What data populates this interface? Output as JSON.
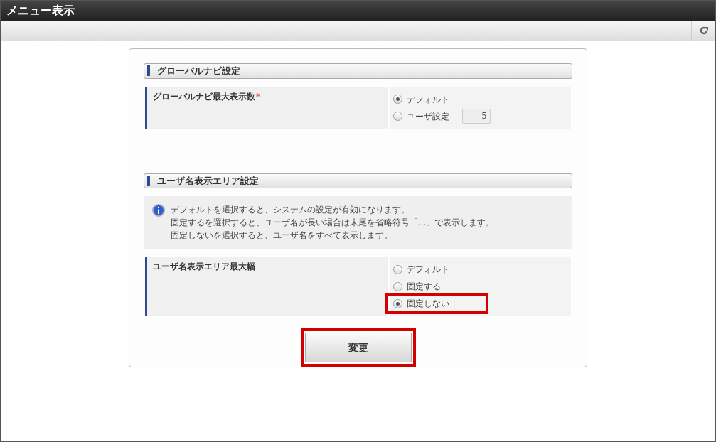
{
  "window": {
    "title": "メニュー表示"
  },
  "sections": [
    {
      "title": "グローバルナビ設定",
      "rows": [
        {
          "label": "グローバルナビ最大表示数",
          "required_mark": "*",
          "options": [
            {
              "label": "デフォルト",
              "selected": true,
              "highlighted": false
            },
            {
              "label": "ユーザ設定",
              "selected": false,
              "highlighted": false,
              "value": "5"
            }
          ]
        }
      ]
    },
    {
      "title": "ユーザ名表示エリア設定",
      "info": [
        "デフォルトを選択すると、システムの設定が有効になります。",
        "固定するを選択すると、ユーザ名が長い場合は末尾を省略符号「...」で表示します。",
        "固定しないを選択すると、ユーザ名をすべて表示します。"
      ],
      "rows": [
        {
          "label": "ユーザ名表示エリア最大幅",
          "options": [
            {
              "label": "デフォルト",
              "selected": false,
              "highlighted": false
            },
            {
              "label": "固定する",
              "selected": false,
              "highlighted": false
            },
            {
              "label": "固定しない",
              "selected": true,
              "highlighted": true
            }
          ]
        }
      ]
    }
  ],
  "submit": {
    "label": "変更",
    "highlighted": true
  }
}
